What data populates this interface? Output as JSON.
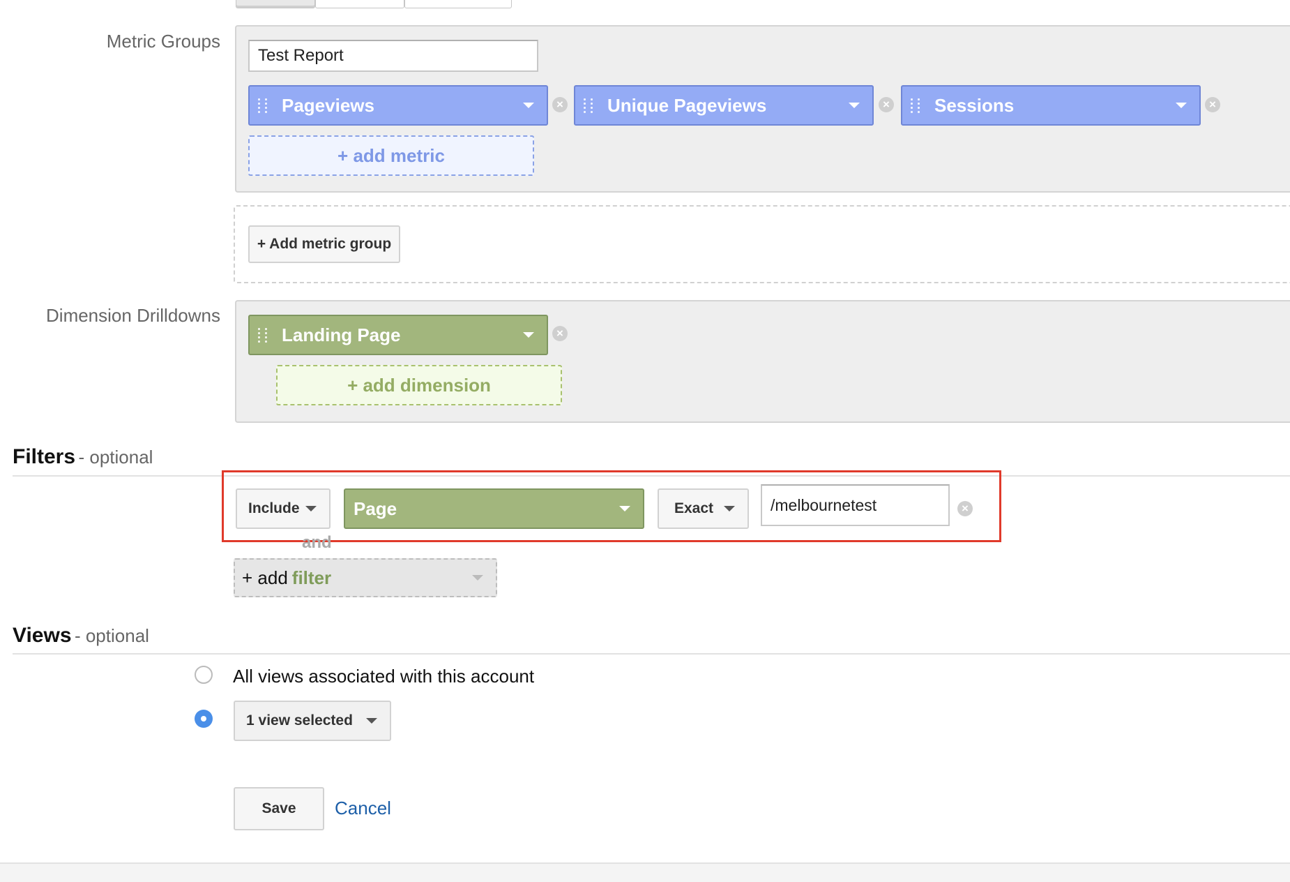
{
  "metric_groups": {
    "label": "Metric Groups",
    "group_name_value": "Test Report",
    "metrics": [
      {
        "label": "Pageviews"
      },
      {
        "label": "Unique Pageviews"
      },
      {
        "label": "Sessions"
      }
    ],
    "add_metric_label": "+ add metric",
    "add_metric_group_label": "+ Add metric group",
    "metric_color": "#94abf5"
  },
  "dimension_drilldowns": {
    "label": "Dimension Drilldowns",
    "dimensions": [
      {
        "label": "Landing Page"
      }
    ],
    "add_dimension_label": "+ add dimension",
    "dimension_color": "#a2b67d"
  },
  "filters": {
    "title": "Filters",
    "subtitle": "- optional",
    "rows": [
      {
        "include": "Include",
        "dimension": "Page",
        "match": "Exact",
        "value": "/melbournetest"
      }
    ],
    "and_label": "and",
    "add_filter_prefix": "+ add",
    "add_filter_word": "filter",
    "highlight_color": "#e03a2b"
  },
  "views": {
    "title": "Views",
    "subtitle": "- optional",
    "option_all_label": "All views associated with this account",
    "option_selected_label": "1 view selected",
    "selected_option": "1 view selected"
  },
  "actions": {
    "save_label": "Save",
    "cancel_label": "Cancel"
  },
  "icons": {
    "remove": "remove-circle-icon",
    "grip": "drag-handle-icon",
    "caret": "caret-down-icon"
  }
}
